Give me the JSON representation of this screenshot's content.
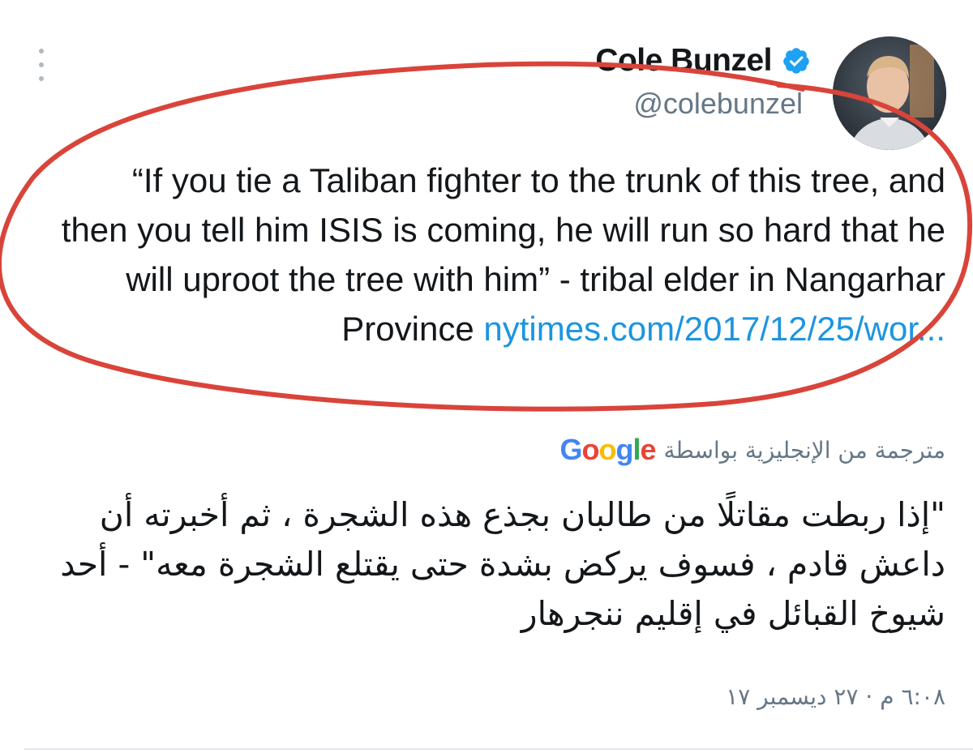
{
  "author": {
    "display_name": "Cole Bunzel",
    "handle": "@colebunzel",
    "verified": true
  },
  "tweet": {
    "text": "“If you tie a Taliban fighter to the trunk of this tree, and then you tell him ISIS is coming, he will run so hard that he will uproot the tree with him” - tribal elder in Nangarhar Province ",
    "link": "nytimes.com/2017/12/25/wor..."
  },
  "translation": {
    "label": "مترجمة من الإنجليزية بواسطة",
    "provider": "Google",
    "text": "\"إذا ربطت مقاتلًا من طالبان بجذع هذه الشجرة ، ثم أخبرته أن داعش قادم ، فسوف يركض بشدة حتى يقتلع الشجرة معه\" - أحد شيوخ القبائل في إقليم ننجرهار"
  },
  "timestamp": "٦:٠٨ م · ٢٧ ديسمبر ١٧",
  "icons": {
    "menu": "more-vertical-icon",
    "verified": "verified-badge-icon"
  },
  "colors": {
    "verified_blue": "#1da1f2",
    "link_blue": "#1b95e0",
    "secondary_text": "#657786",
    "annotation_red": "#d9443a"
  }
}
